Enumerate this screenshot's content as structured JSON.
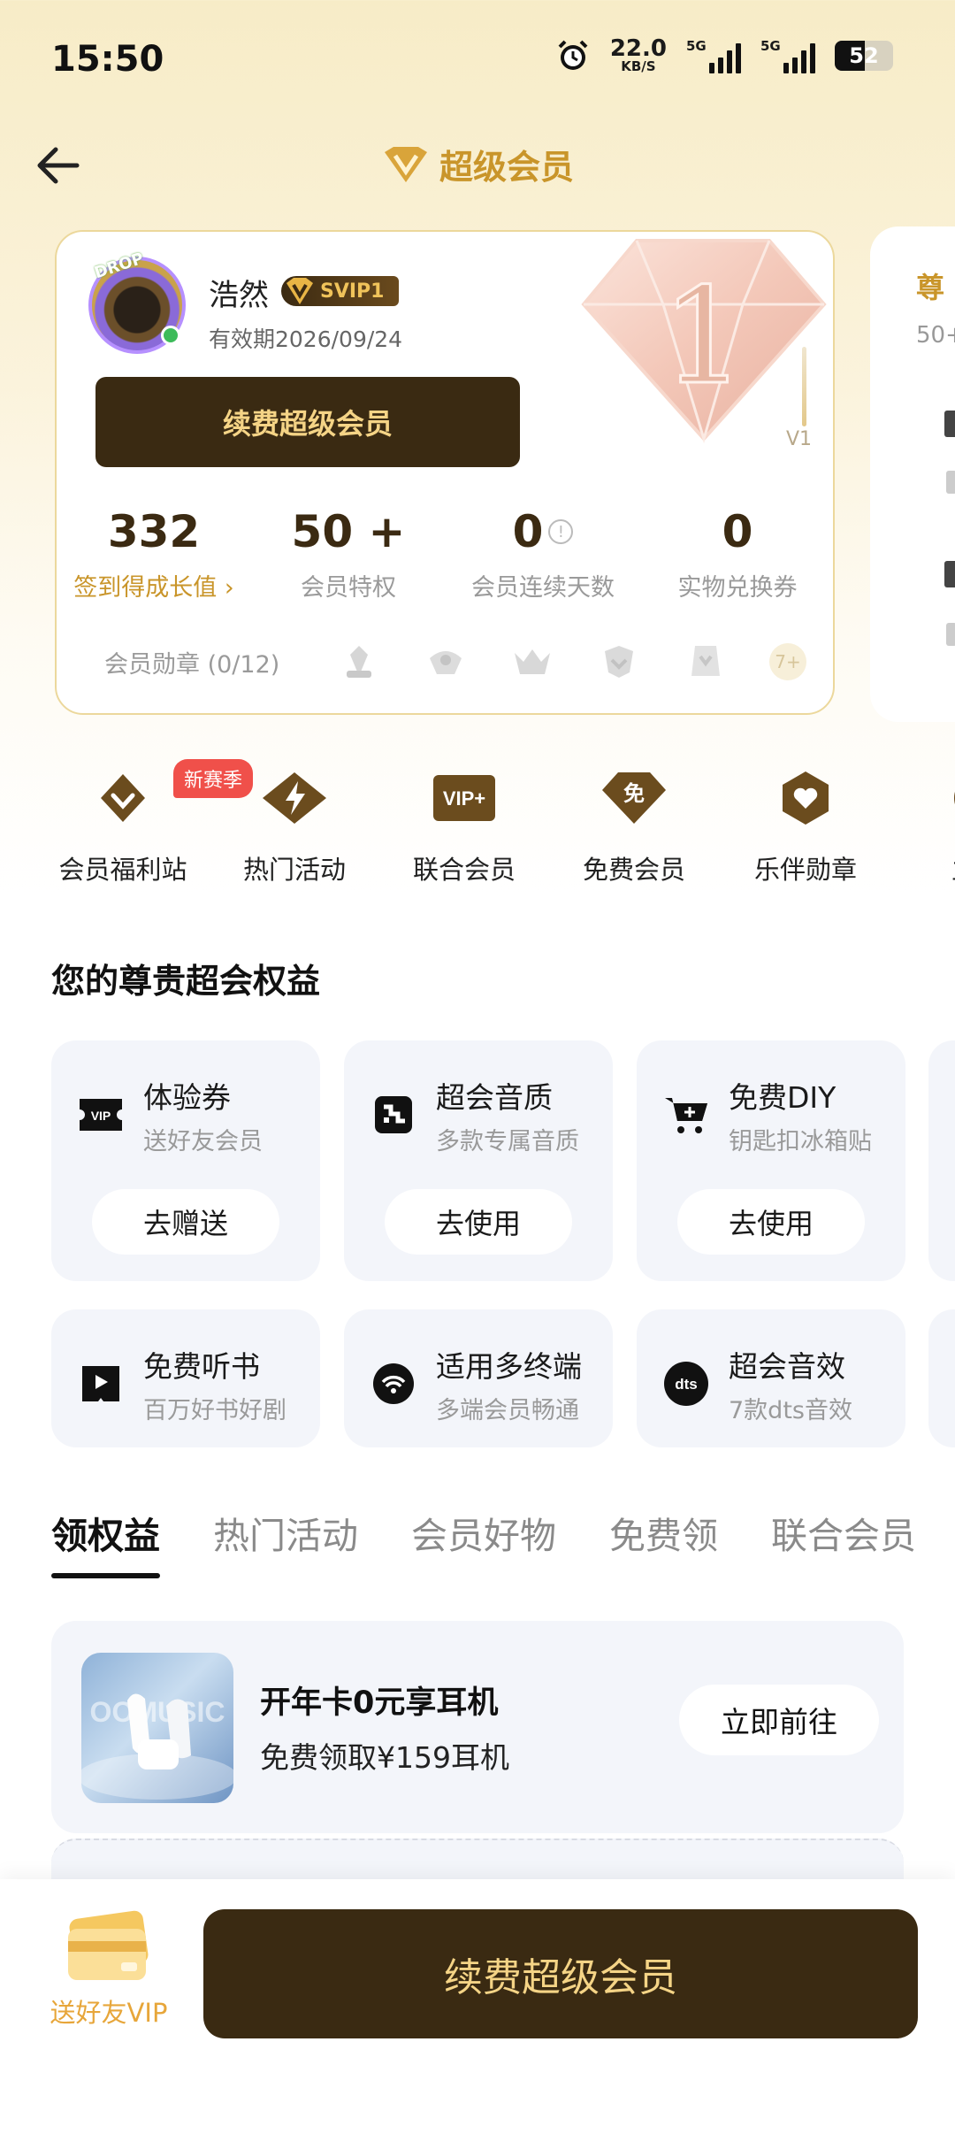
{
  "status_bar": {
    "time": "15:50",
    "net_speed": "22.0",
    "net_unit": "KB/S",
    "sim1": "5G",
    "sim2": "5G",
    "battery": "52",
    "battery_level_pct": 52
  },
  "header": {
    "title": "超级会员"
  },
  "member_card": {
    "avatar_tag": "DROP",
    "username": "浩然",
    "badge": "SVIP1",
    "expire": "有效期2026/09/24",
    "renew_label": "续费超级会员",
    "level": "V1",
    "level_numeral": "1",
    "stats": [
      {
        "value": "332",
        "label": "签到得成长值 ›"
      },
      {
        "value": "50 +",
        "label": "会员特权"
      },
      {
        "value": "0",
        "label": "会员连续天数"
      },
      {
        "value": "0",
        "label": "实物兑换券"
      }
    ],
    "medals_label": "会员勋章 (0/12)",
    "medals_more": "7+"
  },
  "next_card": {
    "title": "尊",
    "sub": "50+"
  },
  "quick_nav": [
    {
      "label": "会员福利站",
      "badge": "新赛季",
      "icon": "gift-diamond-icon"
    },
    {
      "label": "热门活动",
      "icon": "lightning-icon"
    },
    {
      "label": "联合会员",
      "icon": "vip-plus-icon",
      "icon_text": "VIP+"
    },
    {
      "label": "免费会员",
      "icon": "free-icon",
      "icon_text": "免"
    },
    {
      "label": "乐伴勋章",
      "icon": "heart-medal-icon"
    },
    {
      "label": "主题",
      "icon": "theme-icon"
    }
  ],
  "benefits": {
    "title": "您的尊贵超会权益",
    "items": [
      {
        "title": "体验券",
        "sub": "送好友会员",
        "button": "去赠送",
        "icon": "vip-ticket-icon",
        "icon_text": "VIP"
      },
      {
        "title": "超会音质",
        "sub": "多款专属音质",
        "button": "去使用",
        "icon": "sound-quality-icon"
      },
      {
        "title": "免费DIY",
        "sub": "钥匙扣冰箱贴",
        "button": "去使用",
        "icon": "cart-icon"
      },
      {
        "title": "免费听书",
        "sub": "百万好书好剧",
        "icon": "audiobook-icon"
      },
      {
        "title": "适用多终端",
        "sub": "多端会员畅通",
        "icon": "multi-device-icon"
      },
      {
        "title": "超会音效",
        "sub": "7款dts音效",
        "icon": "dts-icon",
        "icon_text": "dts"
      }
    ]
  },
  "tabs": [
    "领权益",
    "热门活动",
    "会员好物",
    "免费领",
    "联合会员"
  ],
  "promo": {
    "title": "开年卡0元享耳机",
    "sub": "免费领取¥159耳机",
    "button": "立即前往",
    "image_text": "OOMUSIC"
  },
  "bottom": {
    "gift_label": "送好友VIP",
    "renew_label": "续费超级会员"
  },
  "colors": {
    "gold": "#c9952a",
    "dark_brown": "#3a2a12",
    "cream": "#f5d486",
    "card_bg": "#f3f5fa",
    "badge_red": "#f0504a"
  }
}
